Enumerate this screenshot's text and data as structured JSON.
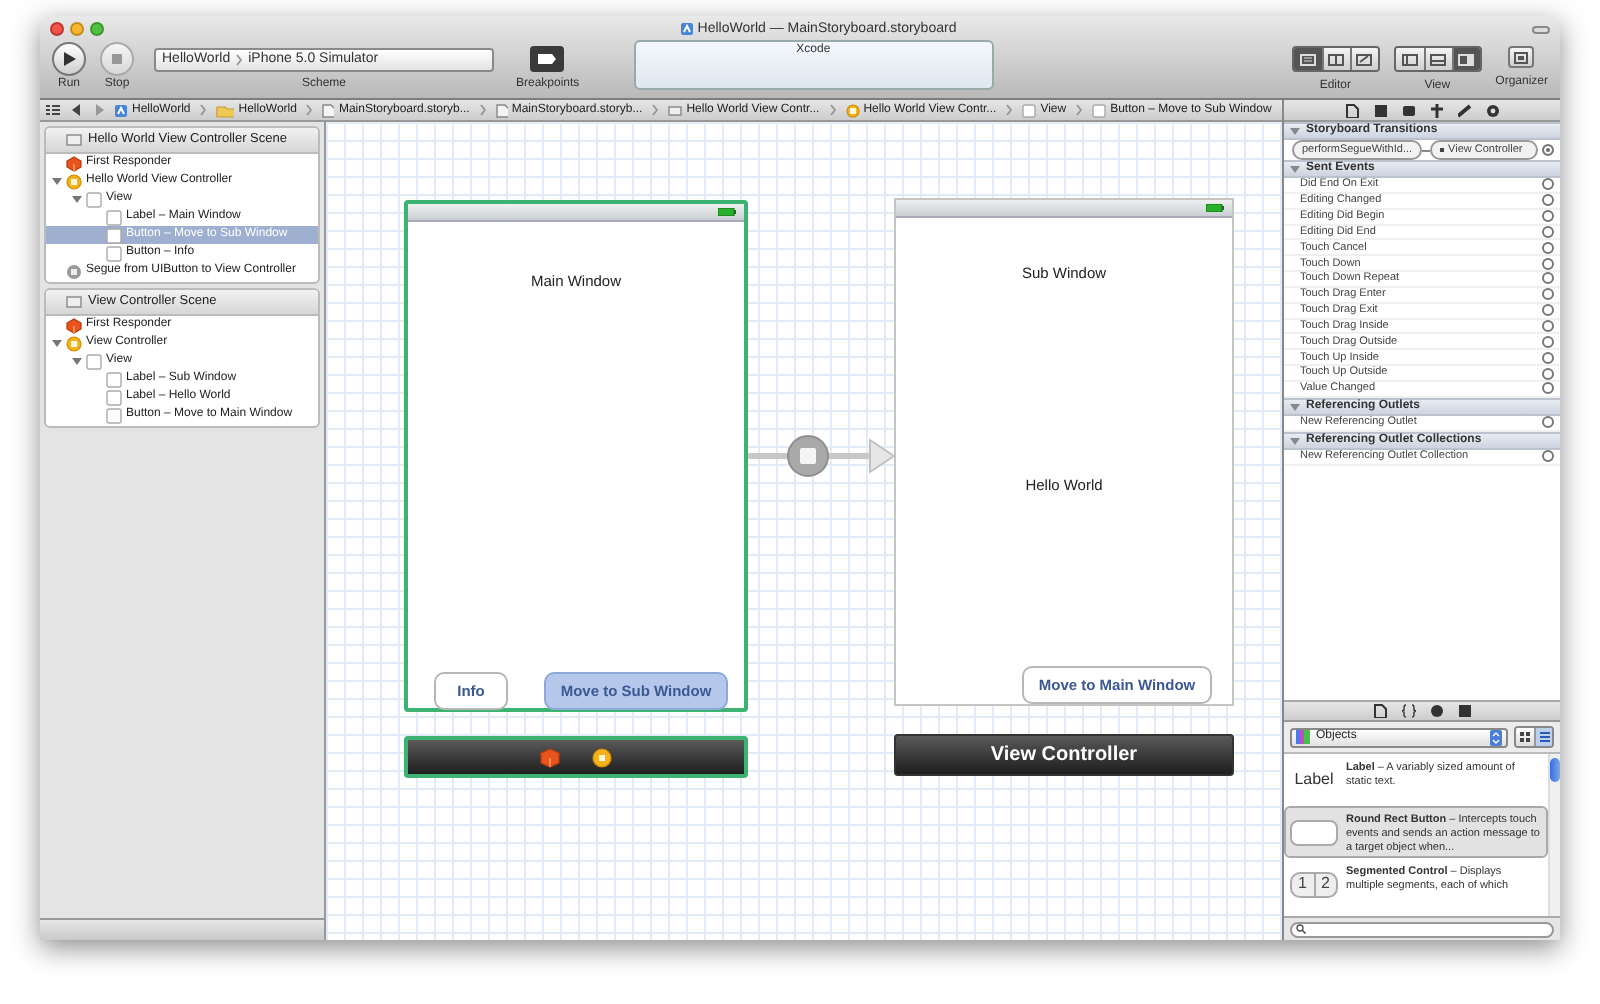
{
  "window": {
    "title": "HelloWorld — MainStoryboard.storyboard"
  },
  "toolbar": {
    "run": "Run",
    "stop": "Stop",
    "scheme_target": "HelloWorld",
    "scheme_device": "iPhone 5.0 Simulator",
    "scheme_label": "Scheme",
    "breakpoints": "Breakpoints",
    "activity": "Xcode",
    "editor_label": "Editor",
    "view_label": "View",
    "organizer_label": "Organizer",
    "editor_modes": [
      {
        "selected": true
      },
      {
        "selected": false
      },
      {
        "selected": false
      }
    ],
    "view_modes": [
      {
        "selected": false
      },
      {
        "selected": false
      },
      {
        "selected": true
      }
    ]
  },
  "jump_bar": [
    {
      "label": "HelloWorld",
      "kind": "project"
    },
    {
      "label": "HelloWorld",
      "kind": "folder"
    },
    {
      "label": "MainStoryboard.storyb...",
      "kind": "file"
    },
    {
      "label": "MainStoryboard.storyb...",
      "kind": "file"
    },
    {
      "label": "Hello World View Contr...",
      "kind": "scene"
    },
    {
      "label": "Hello World View Contr...",
      "kind": "controller"
    },
    {
      "label": "View",
      "kind": "view"
    },
    {
      "label": "Button – Move to Sub Window",
      "kind": "view"
    }
  ],
  "navigator": {
    "scenes": [
      {
        "title": "Hello World View Controller Scene",
        "items": [
          {
            "label": "First Responder",
            "kind": "responder",
            "selected": false
          },
          {
            "label": "Hello World View Controller",
            "kind": "controller",
            "selected": false,
            "expanded": true,
            "children": [
              {
                "label": "View",
                "kind": "view",
                "selected": false,
                "expanded": true,
                "children": [
                  {
                    "label": "Label – Main Window",
                    "kind": "view",
                    "selected": false
                  },
                  {
                    "label": "Button – Move to Sub Window",
                    "kind": "view",
                    "selected": true
                  },
                  {
                    "label": "Button – Info",
                    "kind": "view",
                    "selected": false
                  }
                ]
              }
            ]
          },
          {
            "label": "Segue from UIButton to View Controller",
            "kind": "segue",
            "selected": false
          }
        ]
      },
      {
        "title": "View Controller Scene",
        "items": [
          {
            "label": "First Responder",
            "kind": "responder",
            "selected": false
          },
          {
            "label": "View Controller",
            "kind": "controller",
            "selected": false,
            "expanded": true,
            "children": [
              {
                "label": "View",
                "kind": "view",
                "selected": false,
                "expanded": true,
                "children": [
                  {
                    "label": "Label – Sub Window",
                    "kind": "view",
                    "selected": false
                  },
                  {
                    "label": "Label – Hello World",
                    "kind": "view",
                    "selected": false
                  },
                  {
                    "label": "Button – Move to Main Window",
                    "kind": "view",
                    "selected": false
                  }
                ]
              }
            ]
          }
        ]
      }
    ]
  },
  "canvas": {
    "scenes": [
      {
        "selected": true,
        "elements": [
          {
            "kind": "label",
            "text": "Main Window"
          },
          {
            "kind": "button",
            "text": "Info",
            "selected": false
          },
          {
            "kind": "button",
            "text": "Move to Sub Window",
            "selected": true
          }
        ],
        "dock": {
          "kind": "icons"
        }
      },
      {
        "selected": false,
        "elements": [
          {
            "kind": "label",
            "text": "Sub Window"
          },
          {
            "kind": "label",
            "text": "Hello World"
          },
          {
            "kind": "button",
            "text": "Move to Main Window",
            "selected": false
          }
        ],
        "dock": {
          "kind": "title",
          "title": "View Controller"
        }
      }
    ]
  },
  "inspector": {
    "sections": [
      {
        "title": "Storyboard Transitions",
        "expanded": true,
        "rows": [
          {
            "kind": "transition",
            "label": "performSegueWithId...",
            "target": "View Controller",
            "connected": true
          }
        ]
      },
      {
        "title": "Sent Events",
        "expanded": true,
        "rows": [
          {
            "kind": "event",
            "label": "Did End On Exit",
            "connected": false
          },
          {
            "kind": "event",
            "label": "Editing Changed",
            "connected": false
          },
          {
            "kind": "event",
            "label": "Editing Did Begin",
            "connected": false
          },
          {
            "kind": "event",
            "label": "Editing Did End",
            "connected": false
          },
          {
            "kind": "event",
            "label": "Touch Cancel",
            "connected": false
          },
          {
            "kind": "event",
            "label": "Touch Down",
            "connected": false
          },
          {
            "kind": "event",
            "label": "Touch Down Repeat",
            "connected": false
          },
          {
            "kind": "event",
            "label": "Touch Drag Enter",
            "connected": false
          },
          {
            "kind": "event",
            "label": "Touch Drag Exit",
            "connected": false
          },
          {
            "kind": "event",
            "label": "Touch Drag Inside",
            "connected": false
          },
          {
            "kind": "event",
            "label": "Touch Drag Outside",
            "connected": false
          },
          {
            "kind": "event",
            "label": "Touch Up Inside",
            "connected": false
          },
          {
            "kind": "event",
            "label": "Touch Up Outside",
            "connected": false
          },
          {
            "kind": "event",
            "label": "Value Changed",
            "connected": false
          }
        ]
      },
      {
        "title": "Referencing Outlets",
        "expanded": true,
        "rows": [
          {
            "kind": "event",
            "label": "New Referencing Outlet",
            "connected": false
          }
        ]
      },
      {
        "title": "Referencing Outlet Collections",
        "expanded": true,
        "rows": [
          {
            "kind": "event",
            "label": "New Referencing Outlet Collection",
            "connected": false
          }
        ]
      }
    ]
  },
  "library": {
    "popup": "Objects",
    "view_modes": [
      {
        "selected": false
      },
      {
        "selected": true
      }
    ],
    "items": [
      {
        "kind": "label",
        "preview": "Label",
        "text": "**Label** – A variably sized amount of static text.",
        "selected": false
      },
      {
        "kind": "button",
        "text": "**Round Rect Button** – Intercepts touch events and sends an action message to a target object when...",
        "selected": true
      },
      {
        "kind": "segmented",
        "segments": [
          "1",
          "2"
        ],
        "text": "**Segmented Control** – Displays multiple segments, each of which",
        "selected": false
      }
    ]
  }
}
